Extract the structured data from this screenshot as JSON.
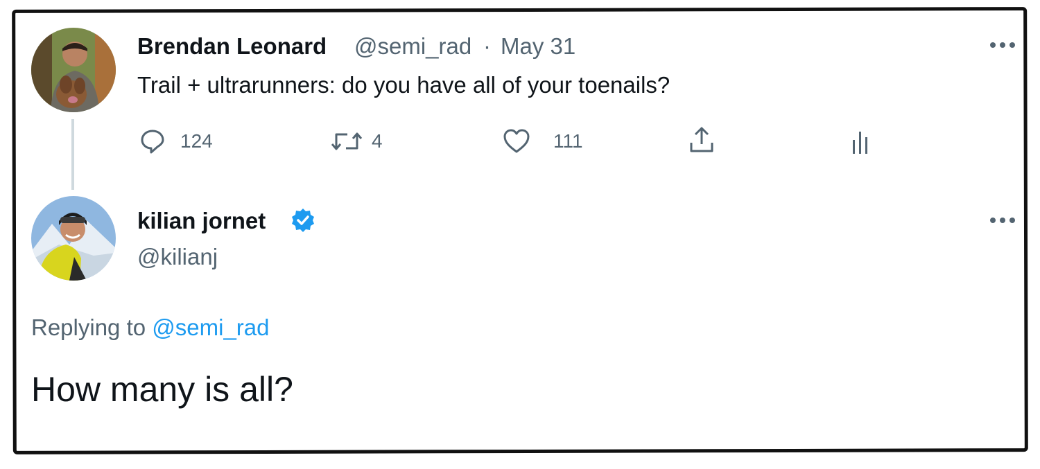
{
  "original_tweet": {
    "display_name": "Brendan Leonard",
    "handle": "@semi_rad",
    "separator": "·",
    "date": "May 31",
    "text": "Trail + ultrarunners: do you have all of your toenails?",
    "actions": {
      "replies": "124",
      "retweets": "4",
      "likes": "111"
    }
  },
  "reply_tweet": {
    "display_name": "kilian jornet",
    "handle": "@kilianj",
    "verified": true,
    "replying_prefix": "Replying to",
    "replying_handle": "@semi_rad",
    "text": "How many is all?"
  },
  "colors": {
    "text": "#0f1419",
    "muted": "#536471",
    "link": "#1d9bf0",
    "verified": "#1d9bf0",
    "thread_line": "#cfd9de",
    "frame_border": "#111111"
  },
  "icons": {
    "reply": "reply-icon",
    "retweet": "retweet-icon",
    "like": "heart-icon",
    "share": "share-icon",
    "analytics": "analytics-icon",
    "more": "more-options-icon",
    "verified": "verified-badge-icon"
  }
}
